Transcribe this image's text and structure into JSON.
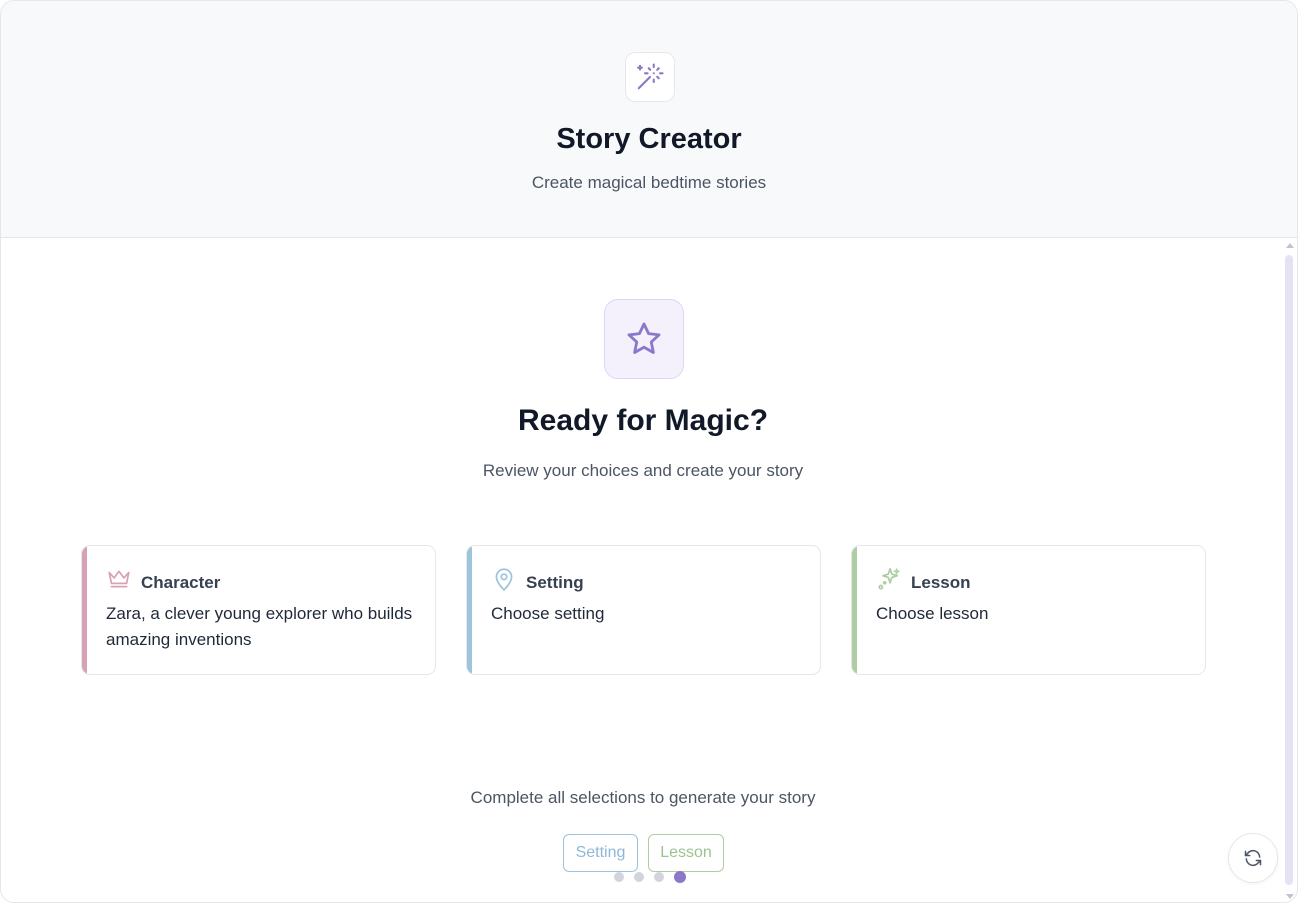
{
  "header": {
    "logo_icon": "magic-wand-icon",
    "title": "Story Creator",
    "subtitle": "Create magical bedtime stories"
  },
  "hero": {
    "icon": "star-icon",
    "title": "Ready for Magic?",
    "subtitle": "Review your choices and create your story"
  },
  "cards": [
    {
      "icon": "crown-icon",
      "title": "Character",
      "value": "Zara, a clever young explorer who builds amazing inventions",
      "accent": "#d8a2b6"
    },
    {
      "icon": "map-pin-icon",
      "title": "Setting",
      "value": "Choose setting",
      "accent": "#9ec3dc"
    },
    {
      "icon": "sparkles-icon",
      "title": "Lesson",
      "value": "Choose lesson",
      "accent": "#aecda2"
    }
  ],
  "status": {
    "message": "Complete all selections to generate your story",
    "missing": [
      "Setting",
      "Lesson"
    ]
  },
  "progress": {
    "steps": 4,
    "current": 4
  },
  "actions": {
    "refresh_icon": "refresh-icon"
  },
  "colors": {
    "brand": "#8b78c9",
    "character_accent": "#d8a2b6",
    "setting_accent": "#9ec3dc",
    "lesson_accent": "#aecda2"
  }
}
